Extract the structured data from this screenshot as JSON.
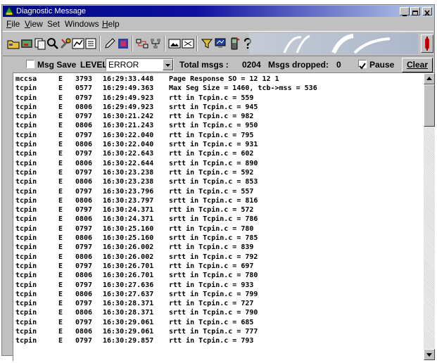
{
  "window": {
    "title": "Diagnostic Message"
  },
  "menu": [
    {
      "label": "File",
      "mnemonic": "F",
      "rest": "ile"
    },
    {
      "label": "View",
      "mnemonic": "V",
      "rest": "iew"
    },
    {
      "label": "Set",
      "mnemonic": "",
      "rest": "Set"
    },
    {
      "label": "Windows",
      "mnemonic": "",
      "rest": "Windows"
    },
    {
      "label": "Help",
      "mnemonic": "H",
      "rest": "elp"
    }
  ],
  "toolbar_icons": [
    "open-folder-icon",
    "save-image-icon",
    "copy-icon",
    "search-icon",
    "tools-icon",
    "chart-icon",
    "list-icon",
    "edit-icon",
    "layers-icon",
    "transfer-icon",
    "network-icon",
    "image-icon",
    "photo-icon",
    "filter-icon",
    "monitor-icon",
    "phone-icon",
    "help-icon"
  ],
  "options": {
    "msg_save_label": "Msg Save",
    "msg_save_checked": false,
    "level_label": "LEVEL:",
    "level_value": "ERROR",
    "total_label": "Total msgs :",
    "total_value": "0204",
    "dropped_label": "Msgs dropped:",
    "dropped_value": "0",
    "pause_label": "Pause",
    "pause_checked": true,
    "clear_label": "Clear"
  },
  "log_rows": [
    [
      "mccsa",
      "E",
      "3793",
      "16:29:33.448",
      "Page Response SO = 12 12 1"
    ],
    [
      "tcpin",
      "E",
      "0577",
      "16:29:49.363",
      "Max Seg Size = 1460, tcb->mss = 536"
    ],
    [
      "tcpin",
      "E",
      "0797",
      "16:29:49.923",
      "rtt in Tcpin.c = 559"
    ],
    [
      "tcpin",
      "E",
      "0806",
      "16:29:49.923",
      "srtt in Tcpin.c = 945"
    ],
    [
      "tcpin",
      "E",
      "0797",
      "16:30:21.242",
      "rtt in Tcpin.c = 982"
    ],
    [
      "tcpin",
      "E",
      "0806",
      "16:30:21.243",
      "srtt in Tcpin.c = 950"
    ],
    [
      "tcpin",
      "E",
      "0797",
      "16:30:22.040",
      "rtt in Tcpin.c = 795"
    ],
    [
      "tcpin",
      "E",
      "0806",
      "16:30:22.040",
      "srtt in Tcpin.c = 931"
    ],
    [
      "tcpin",
      "E",
      "0797",
      "16:30:22.643",
      "rtt in Tcpin.c = 602"
    ],
    [
      "tcpin",
      "E",
      "0806",
      "16:30:22.644",
      "srtt in Tcpin.c = 890"
    ],
    [
      "tcpin",
      "E",
      "0797",
      "16:30:23.238",
      "rtt in Tcpin.c = 592"
    ],
    [
      "tcpin",
      "E",
      "0806",
      "16:30:23.238",
      "srtt in Tcpin.c = 853"
    ],
    [
      "tcpin",
      "E",
      "0797",
      "16:30:23.796",
      "rtt in Tcpin.c = 557"
    ],
    [
      "tcpin",
      "E",
      "0806",
      "16:30:23.797",
      "srtt in Tcpin.c = 816"
    ],
    [
      "tcpin",
      "E",
      "0797",
      "16:30:24.371",
      "rtt in Tcpin.c = 572"
    ],
    [
      "tcpin",
      "E",
      "0806",
      "16:30:24.371",
      "srtt in Tcpin.c = 786"
    ],
    [
      "tcpin",
      "E",
      "0797",
      "16:30:25.160",
      "rtt in Tcpin.c = 780"
    ],
    [
      "tcpin",
      "E",
      "0806",
      "16:30:25.160",
      "srtt in Tcpin.c = 785"
    ],
    [
      "tcpin",
      "E",
      "0797",
      "16:30:26.002",
      "rtt in Tcpin.c = 839"
    ],
    [
      "tcpin",
      "E",
      "0806",
      "16:30:26.002",
      "srtt in Tcpin.c = 792"
    ],
    [
      "tcpin",
      "E",
      "0797",
      "16:30:26.701",
      "rtt in Tcpin.c = 697"
    ],
    [
      "tcpin",
      "E",
      "0806",
      "16:30:26.701",
      "srtt in Tcpin.c = 780"
    ],
    [
      "tcpin",
      "E",
      "0797",
      "16:30:27.636",
      "rtt in Tcpin.c = 933"
    ],
    [
      "tcpin",
      "E",
      "0806",
      "16:30:27.637",
      "srtt in Tcpin.c = 799"
    ],
    [
      "tcpin",
      "E",
      "0797",
      "16:30:28.371",
      "rtt in Tcpin.c = 727"
    ],
    [
      "tcpin",
      "E",
      "0806",
      "16:30:28.371",
      "srtt in Tcpin.c = 790"
    ],
    [
      "tcpin",
      "E",
      "0797",
      "16:30:29.061",
      "rtt in Tcpin.c = 685"
    ],
    [
      "tcpin",
      "E",
      "0806",
      "16:30:29.061",
      "srtt in Tcpin.c = 777"
    ],
    [
      "tcpin",
      "E",
      "0797",
      "16:30:29.857",
      "rtt in Tcpin.c = 793"
    ]
  ],
  "colors": {
    "title_active": "#000a82",
    "face": "#c0c0c0",
    "pause_red": "#e00000"
  }
}
